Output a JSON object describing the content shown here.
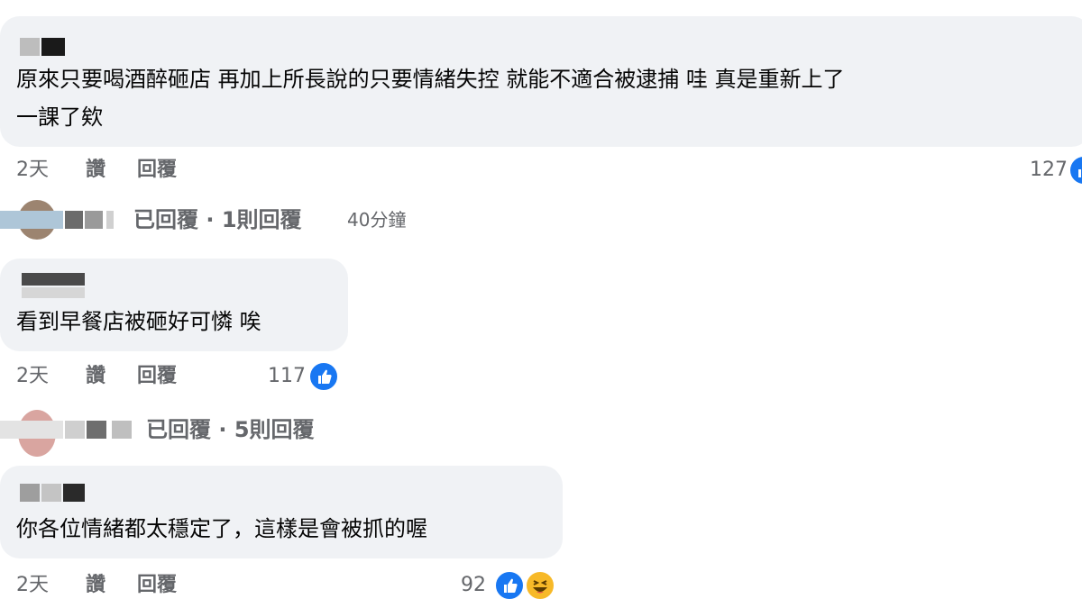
{
  "comments": [
    {
      "text_lines": [
        "原來只要喝酒醉砸店 再加上所長說的只要情緒失控 就能不適合被逮捕 哇 真是重新上了",
        "一課了欸"
      ],
      "time": "2天",
      "like": "讚",
      "reply": "回覆",
      "reaction_count": "127",
      "reactions": [
        "like-icon"
      ],
      "reply_summary": {
        "author": "",
        "text": "已回覆 · 1則回覆",
        "time": "40分鐘"
      }
    },
    {
      "text_lines": [
        "看到早餐店被砸好可憐 唉"
      ],
      "time": "2天",
      "like": "讚",
      "reply": "回覆",
      "reaction_count": "117",
      "reactions": [
        "like-icon"
      ],
      "reply_summary": {
        "author": "",
        "text": "已回覆 · 5則回覆",
        "time": ""
      }
    },
    {
      "text_lines": [
        "你各位情緒都太穩定了，這樣是會被抓的喔"
      ],
      "time": "2天",
      "like": "讚",
      "reply": "回覆",
      "reaction_count": "92",
      "reactions": [
        "like-icon",
        "haha-icon"
      ]
    }
  ],
  "colors": {
    "bubble": "#f0f2f5",
    "secondary_text": "#65676b",
    "like_blue": "#1877f2",
    "haha_yellow": "#f7b928"
  }
}
